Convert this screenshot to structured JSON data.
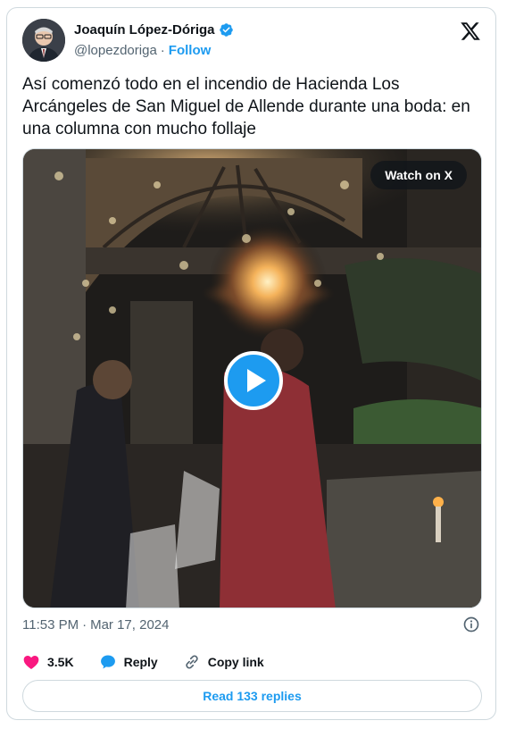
{
  "author": {
    "name": "Joaquín López-Dóriga",
    "handle": "@lopezdoriga",
    "separator": "·",
    "follow_label": "Follow"
  },
  "tweet": {
    "text": "Así comenzó todo en el incendio de Hacienda Los Arcángeles de San Miguel de Allende durante una boda: en una columna con mucho follaje"
  },
  "media": {
    "watch_label": "Watch on X",
    "play_icon": "play-icon"
  },
  "meta": {
    "time": "11:53 PM",
    "separator": "·",
    "date": "Mar 17, 2024"
  },
  "actions": {
    "likes_count": "3.5K",
    "reply_label": "Reply",
    "copy_link_label": "Copy link"
  },
  "read_replies_label": "Read 133 replies",
  "colors": {
    "accent": "#1d9bf0",
    "like": "#f91880",
    "text": "#0f1419",
    "muted": "#536471",
    "border": "#cfd9de"
  }
}
